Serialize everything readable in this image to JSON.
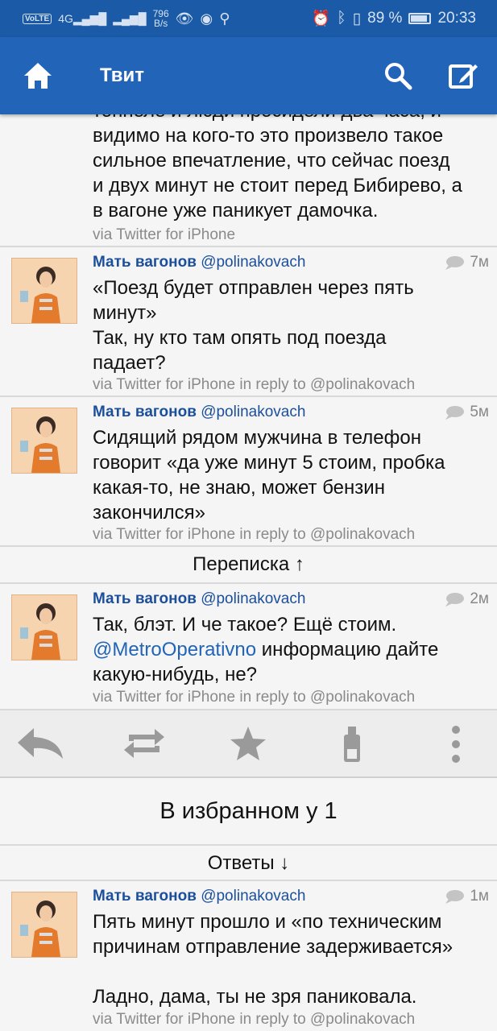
{
  "status_bar": {
    "network_badge": "VoLTE",
    "signal": "4G",
    "speed_value": "796",
    "speed_unit": "B/s",
    "battery": "89 %",
    "battery_level": 0.89,
    "time": "20:33"
  },
  "app_bar": {
    "title": "Твит"
  },
  "tweets": [
    {
      "text": "тоннеле и люди просидели два часа, и\nвидимо на кого-то это произвело такое\nсильное впечатление, что сейчас поезд\nи двух минут не стоит перед Бибирево, а\nв вагоне уже паникует дамочка.",
      "via": "via Twitter for iPhone"
    },
    {
      "name": "Мать вагонов",
      "handle": "@polinakovach",
      "time": "7м",
      "text": "«Поезд будет отправлен через пять\nминут»\nТак, ну кто там опять под поезда\nпадает?",
      "via": "via Twitter for iPhone in reply to @polinakovach"
    },
    {
      "name": "Мать вагонов",
      "handle": "@polinakovach",
      "time": "5м",
      "text": "Сидящий рядом мужчина в телефон\nговорит «да уже минут 5 стоим, пробка\nкакая-то, не знаю, может бензин\nзакончился»",
      "via": "via Twitter for iPhone in reply to @polinakovach"
    },
    {
      "name": "Мать вагонов",
      "handle": "@polinakovach",
      "time": "2м",
      "text_pre": "Так, блэт. И че такое? Ещё стоим.\n",
      "mention": "@MetroOperativno",
      "text_post": " информацию дайте\nкакую-нибудь, не?",
      "via": "via Twitter for iPhone in reply to @polinakovach"
    },
    {
      "name": "Мать вагонов",
      "handle": "@polinakovach",
      "time": "1м",
      "text": "Пять минут прошло и «по техническим\nпричинам отправление задерживается»\n\nЛадно, дама, ты не зря паниковала.",
      "via": "via Twitter for iPhone in reply to @polinakovach"
    }
  ],
  "conversation_label": "Переписка ↑",
  "favorites_label": "В избранном у 1",
  "replies_label": "Ответы ↓",
  "actions": [
    "reply-icon",
    "retweet-icon",
    "star-icon",
    "share-icon",
    "more-icon"
  ],
  "colors": {
    "app_bar": "#2164b8",
    "status_bar": "#1a5aa6",
    "name": "#1b4f9c",
    "action_icon": "#9a9a9a"
  }
}
